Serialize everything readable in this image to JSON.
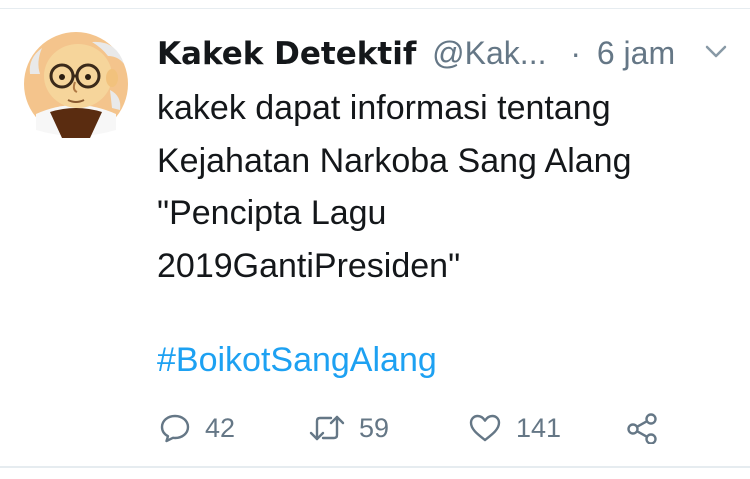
{
  "tweet": {
    "author_name": "Kakek Detektif",
    "author_handle": "@Kak...",
    "separator": "·",
    "time": "6 jam",
    "text_lines": [
      "kakek dapat informasi tentang",
      "Kejahatan Narkoba Sang Alang",
      "\"Pencipta Lagu",
      "2019GantiPresiden\""
    ],
    "hashtag": "#BoikotSangAlang"
  },
  "actions": {
    "replies": "42",
    "retweets": "59",
    "likes": "141"
  },
  "colors": {
    "link": "#1da1f2",
    "muted": "#657786",
    "text": "#14171a"
  }
}
